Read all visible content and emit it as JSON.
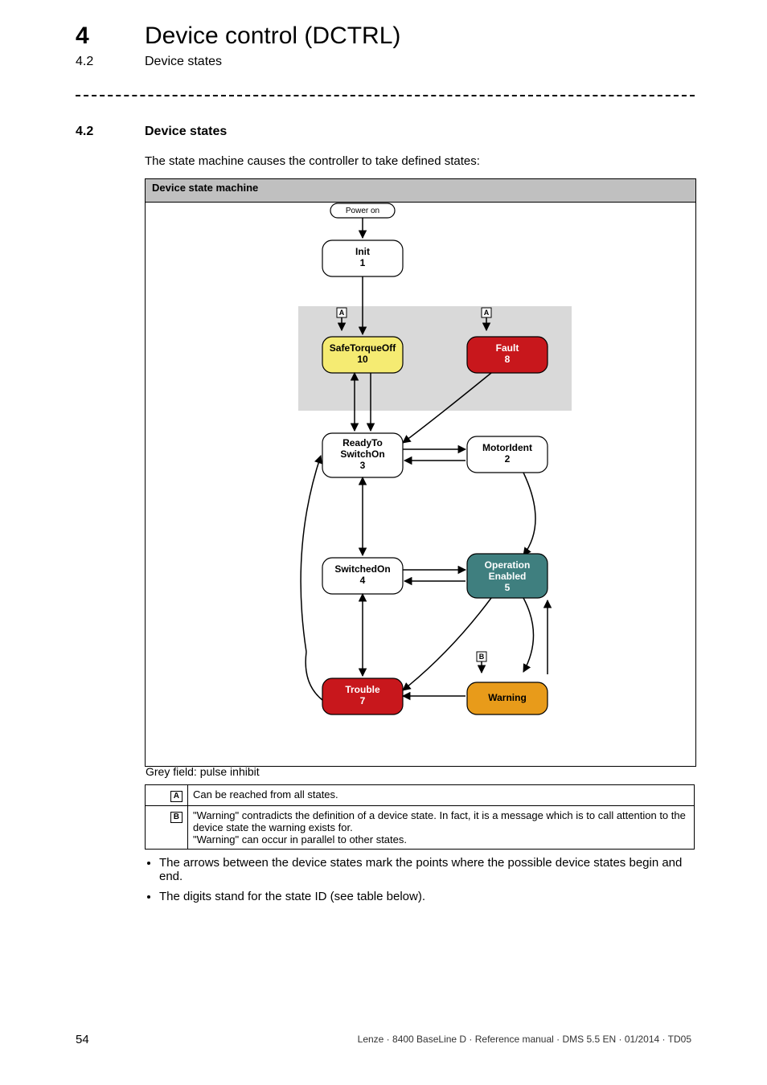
{
  "chapter": {
    "num": "4",
    "title": "Device control (DCTRL)"
  },
  "subsection_ref": {
    "num": "4.2",
    "title": "Device states"
  },
  "section": {
    "num": "4.2",
    "title": "Device states"
  },
  "intro": "The state machine causes the controller to take defined states:",
  "figure": {
    "header": "Device state machine",
    "grey_caption": "Grey field: pulse inhibit",
    "states": {
      "power_on": "Power on",
      "init": {
        "name": "Init",
        "id": "1"
      },
      "sto": {
        "name": "SafeTorqueOff",
        "id": "10"
      },
      "fault": {
        "name": "Fault",
        "id": "8"
      },
      "ready": {
        "name": "ReadyTo\nSwitchOn",
        "id": "3"
      },
      "motorident": {
        "name": "MotorIdent",
        "id": "2"
      },
      "switchedon": {
        "name": "SwitchedOn",
        "id": "4"
      },
      "opena": {
        "name": "Operation\nEnabled",
        "id": "5"
      },
      "trouble": {
        "name": "Trouble",
        "id": "7"
      },
      "warning": {
        "name": "Warning"
      }
    },
    "markers": {
      "A": "A",
      "B": "B"
    }
  },
  "legend": {
    "A": "Can be reached from all states.",
    "B": "\"Warning\" contradicts the definition of a device state. In fact, it is a message which is to call attention to the device state the warning exists for.\n\"Warning\" can occur in parallel to other states."
  },
  "bullets": [
    "The arrows between the device states mark the points where the possible device states begin and end.",
    "The digits stand for the state ID (see table below)."
  ],
  "footer": {
    "page": "54",
    "line": "Lenze · 8400 BaseLine D · Reference manual · DMS 5.5 EN · 01/2014 · TD05"
  }
}
